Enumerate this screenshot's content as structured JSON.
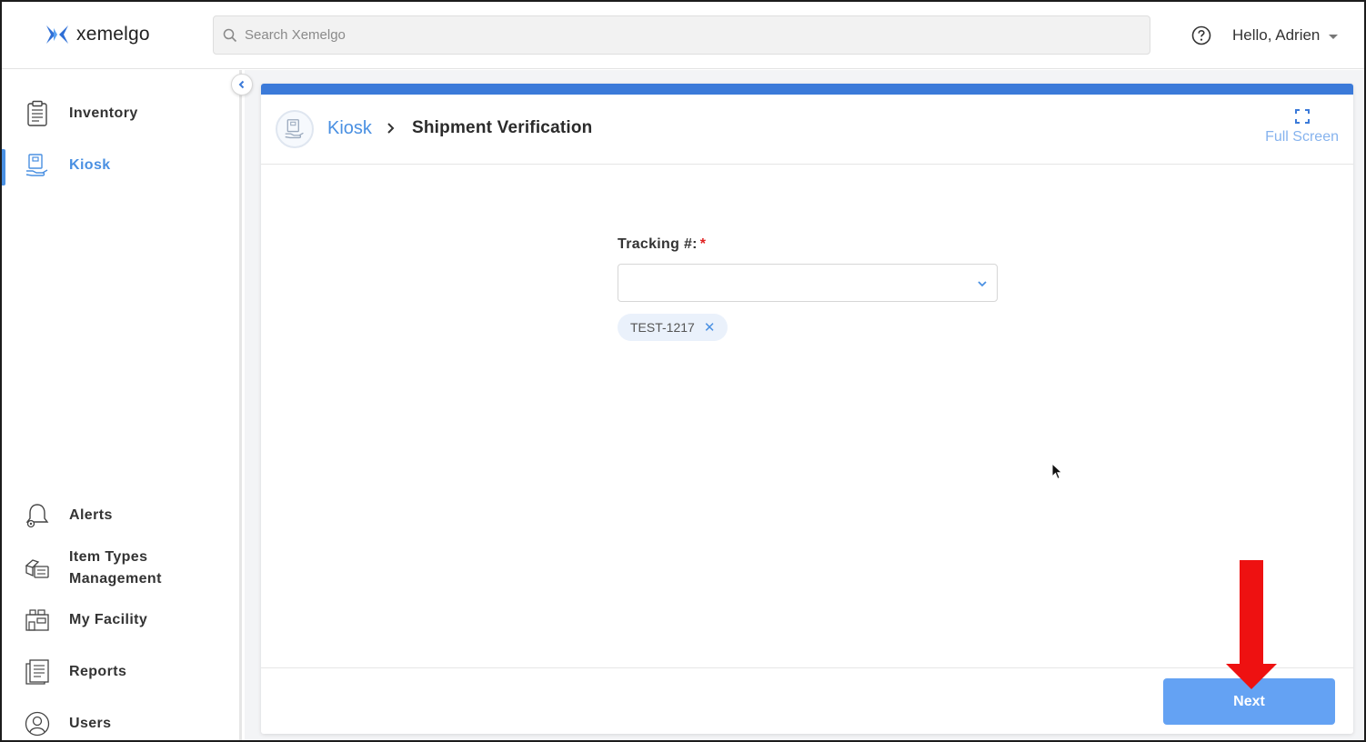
{
  "header": {
    "logo_text": "xemelgo",
    "search_placeholder": "Search Xemelgo",
    "greeting": "Hello, Adrien"
  },
  "sidebar": {
    "top_items": [
      {
        "label": "Inventory",
        "icon": "clipboard-icon",
        "active": false
      },
      {
        "label": "Kiosk",
        "icon": "kiosk-icon",
        "active": true
      }
    ],
    "bottom_items": [
      {
        "label": "Alerts",
        "icon": "bell-icon"
      },
      {
        "label_line1": "Item Types",
        "label_line2": "Management",
        "icon": "item-types-icon"
      },
      {
        "label": "My Facility",
        "icon": "facility-icon"
      },
      {
        "label": "Reports",
        "icon": "reports-icon"
      },
      {
        "label": "Users",
        "icon": "user-icon"
      }
    ]
  },
  "breadcrumb": {
    "root": "Kiosk",
    "current": "Shipment Verification"
  },
  "fullscreen_label": "Full Screen",
  "form": {
    "tracking_label": "Tracking #:",
    "required_mark": "*",
    "selected_value": "",
    "chips": [
      "TEST-1217"
    ],
    "chip_remove": "✕"
  },
  "footer": {
    "next_label": "Next"
  },
  "colors": {
    "accent": "#4a90e2",
    "top_bar": "#3b7ad9",
    "next_button": "#64a2f3",
    "annotation_arrow": "#ee1111"
  }
}
